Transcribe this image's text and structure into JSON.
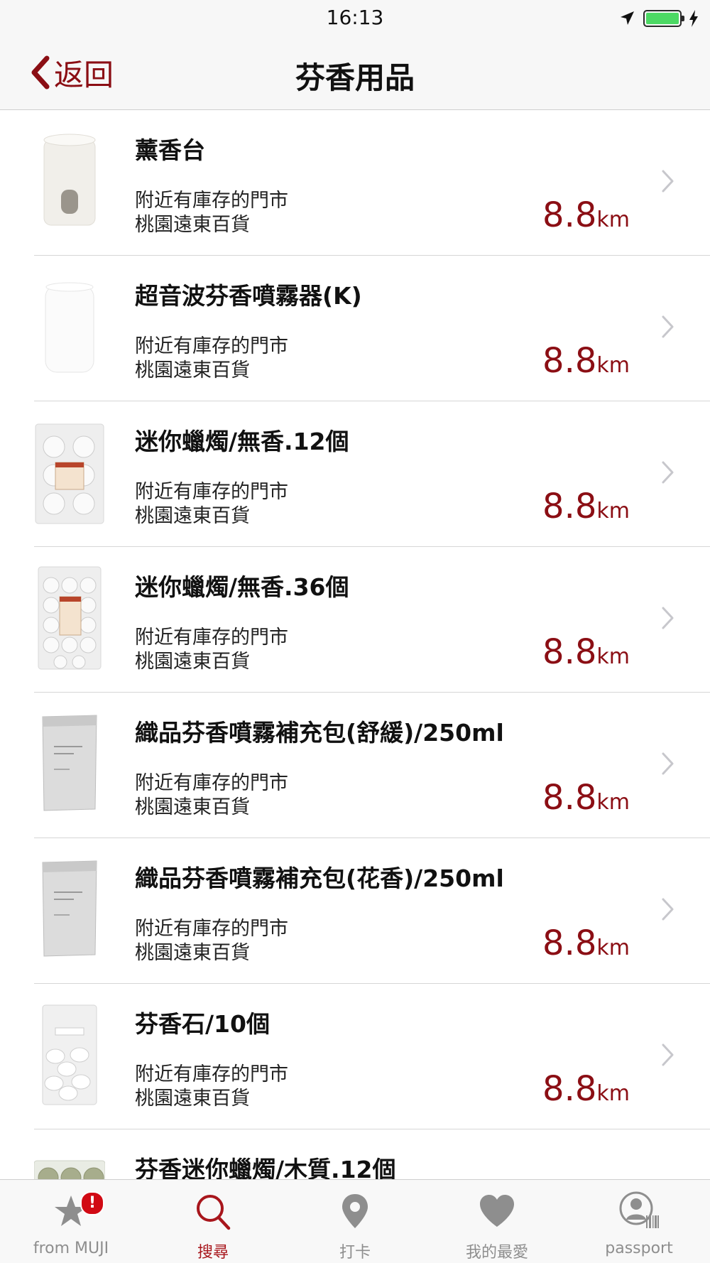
{
  "status_bar": {
    "time": "16:13"
  },
  "nav": {
    "back_label": "返回",
    "title": "芬香用品"
  },
  "products": [
    {
      "name": "薰香台",
      "stock_label": "附近有庫存的門市",
      "store": "桃園遠東百貨",
      "distance": "8.8",
      "unit": "km"
    },
    {
      "name": "超音波芬香噴霧器(K)",
      "stock_label": "附近有庫存的門市",
      "store": "桃園遠東百貨",
      "distance": "8.8",
      "unit": "km"
    },
    {
      "name": "迷你蠟燭/無香.12個",
      "stock_label": "附近有庫存的門市",
      "store": "桃園遠東百貨",
      "distance": "8.8",
      "unit": "km"
    },
    {
      "name": "迷你蠟燭/無香.36個",
      "stock_label": "附近有庫存的門市",
      "store": "桃園遠東百貨",
      "distance": "8.8",
      "unit": "km"
    },
    {
      "name": "織品芬香噴霧補充包(舒緩)/250ml",
      "stock_label": "附近有庫存的門市",
      "store": "桃園遠東百貨",
      "distance": "8.8",
      "unit": "km"
    },
    {
      "name": "織品芬香噴霧補充包(花香)/250ml",
      "stock_label": "附近有庫存的門市",
      "store": "桃園遠東百貨",
      "distance": "8.8",
      "unit": "km"
    },
    {
      "name": "芬香石/10個",
      "stock_label": "附近有庫存的門市",
      "store": "桃園遠東百貨",
      "distance": "8.8",
      "unit": "km"
    },
    {
      "name": "芬香迷你蠟燭/木質.12個"
    }
  ],
  "tab_bar": {
    "tabs": [
      {
        "label": "from MUJI",
        "icon": "star-icon",
        "badge": "!"
      },
      {
        "label": "搜尋",
        "icon": "search-icon",
        "active": true
      },
      {
        "label": "打卡",
        "icon": "map-pin-icon"
      },
      {
        "label": "我的最愛",
        "icon": "heart-icon"
      },
      {
        "label": "passport",
        "icon": "passport-icon"
      }
    ]
  },
  "colors": {
    "accent": "#8b0e14",
    "battery": "#4cd964",
    "badge": "#d10a14"
  }
}
